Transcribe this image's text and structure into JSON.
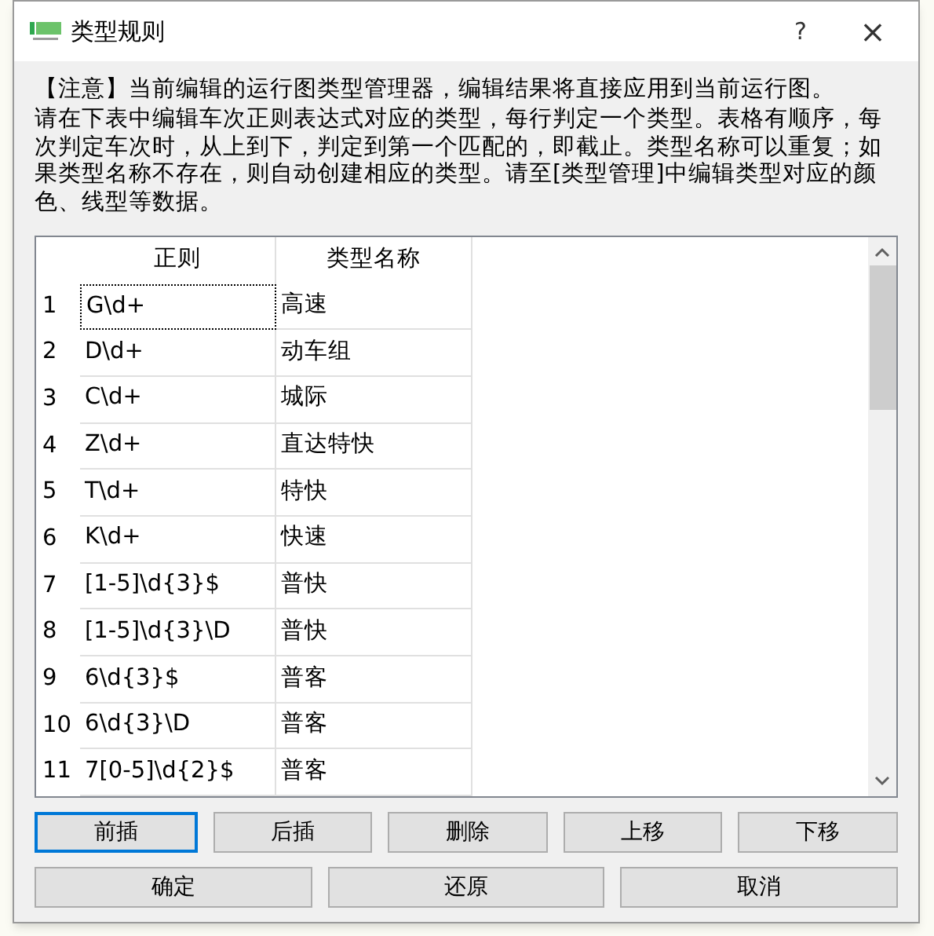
{
  "window": {
    "title": "类型规则",
    "help": "?",
    "close": "×"
  },
  "notice": "【注意】当前编辑的运行图类型管理器，编辑结果将直接应用到当前运行图。",
  "instructions": "请在下表中编辑车次正则表达式对应的类型，每行判定一个类型。表格有顺序，每次判定车次时，从上到下，判定到第一个匹配的，即截止。类型名称可以重复；如果类型名称不存在，则自动创建相应的类型。请至[类型管理]中编辑类型对应的颜色、线型等数据。",
  "table": {
    "columns": [
      "正则",
      "类型名称"
    ],
    "rows": [
      {
        "index": "1",
        "regex": "G\\d+",
        "type": "高速",
        "current": true
      },
      {
        "index": "2",
        "regex": "D\\d+",
        "type": "动车组",
        "current": false
      },
      {
        "index": "3",
        "regex": "C\\d+",
        "type": "城际",
        "current": false
      },
      {
        "index": "4",
        "regex": "Z\\d+",
        "type": "直达特快",
        "current": false
      },
      {
        "index": "5",
        "regex": "T\\d+",
        "type": "特快",
        "current": false
      },
      {
        "index": "6",
        "regex": "K\\d+",
        "type": "快速",
        "current": false
      },
      {
        "index": "7",
        "regex": "[1-5]\\d{3}$",
        "type": "普快",
        "current": false
      },
      {
        "index": "8",
        "regex": "[1-5]\\d{3}\\D",
        "type": "普快",
        "current": false
      },
      {
        "index": "9",
        "regex": "6\\d{3}$",
        "type": "普客",
        "current": false
      },
      {
        "index": "10",
        "regex": "6\\d{3}\\D",
        "type": "普客",
        "current": false
      },
      {
        "index": "11",
        "regex": "7[0-5]\\d{2}$",
        "type": "普客",
        "current": false
      }
    ]
  },
  "edit_buttons": [
    {
      "label": "前插",
      "focused": true
    },
    {
      "label": "后插",
      "focused": false
    },
    {
      "label": "删除",
      "focused": false
    },
    {
      "label": "上移",
      "focused": false
    },
    {
      "label": "下移",
      "focused": false
    }
  ],
  "dialog_buttons": [
    {
      "label": "确定",
      "focused": false
    },
    {
      "label": "还原",
      "focused": false
    },
    {
      "label": "取消",
      "focused": false
    }
  ]
}
